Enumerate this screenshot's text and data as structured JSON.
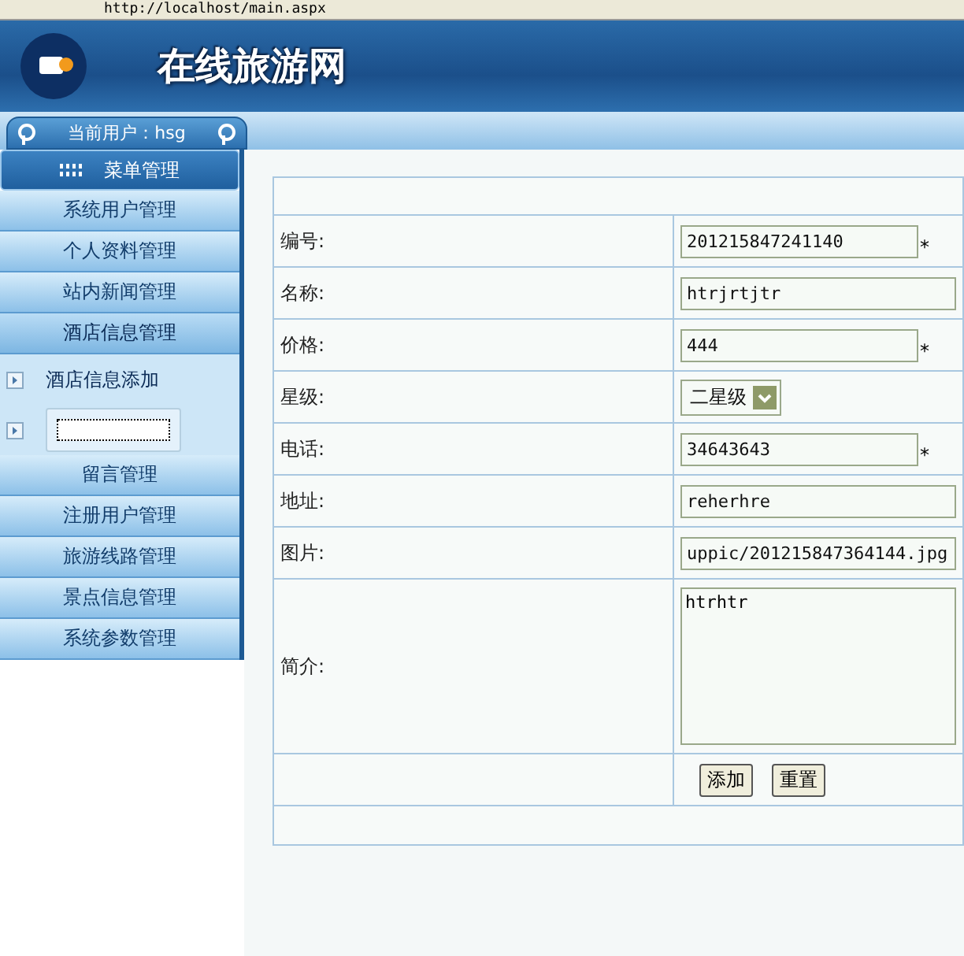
{
  "address_bar": {
    "url": "http://localhost/main.aspx"
  },
  "header": {
    "title": "在线旅游网"
  },
  "user": {
    "label": "当前用户：hsg"
  },
  "sidebar": {
    "title": "菜单管理",
    "items": [
      {
        "label": "系统用户管理",
        "expanded": false
      },
      {
        "label": "个人资料管理",
        "expanded": false
      },
      {
        "label": "站内新闻管理",
        "expanded": false
      },
      {
        "label": "酒店信息管理",
        "expanded": true,
        "children": [
          {
            "label": "酒店信息添加",
            "focused": false
          },
          {
            "focused": true
          }
        ]
      },
      {
        "label": "留言管理",
        "expanded": false
      },
      {
        "label": "注册用户管理",
        "expanded": false
      },
      {
        "label": "旅游线路管理",
        "expanded": false
      },
      {
        "label": "景点信息管理",
        "expanded": false
      },
      {
        "label": "系统参数管理",
        "expanded": false
      }
    ]
  },
  "form": {
    "fields": [
      {
        "label": "编号:",
        "kind": "text",
        "value": "201215847241140",
        "note": "*"
      },
      {
        "label": "名称:",
        "kind": "text",
        "value": "htrjrtjtr"
      },
      {
        "label": "价格:",
        "kind": "text",
        "value": "444",
        "note": "*"
      },
      {
        "label": "星级:",
        "kind": "select",
        "value": "二星级"
      },
      {
        "label": "电话:",
        "kind": "text",
        "value": "34643643",
        "note": "*"
      },
      {
        "label": "地址:",
        "kind": "text",
        "value": "reherhre"
      },
      {
        "label": "图片:",
        "kind": "text",
        "value": "uppic/201215847364144.jpg"
      },
      {
        "label": "简介:",
        "kind": "textarea",
        "value": "htrhtr"
      }
    ],
    "buttons": [
      "添加",
      "重置"
    ]
  }
}
